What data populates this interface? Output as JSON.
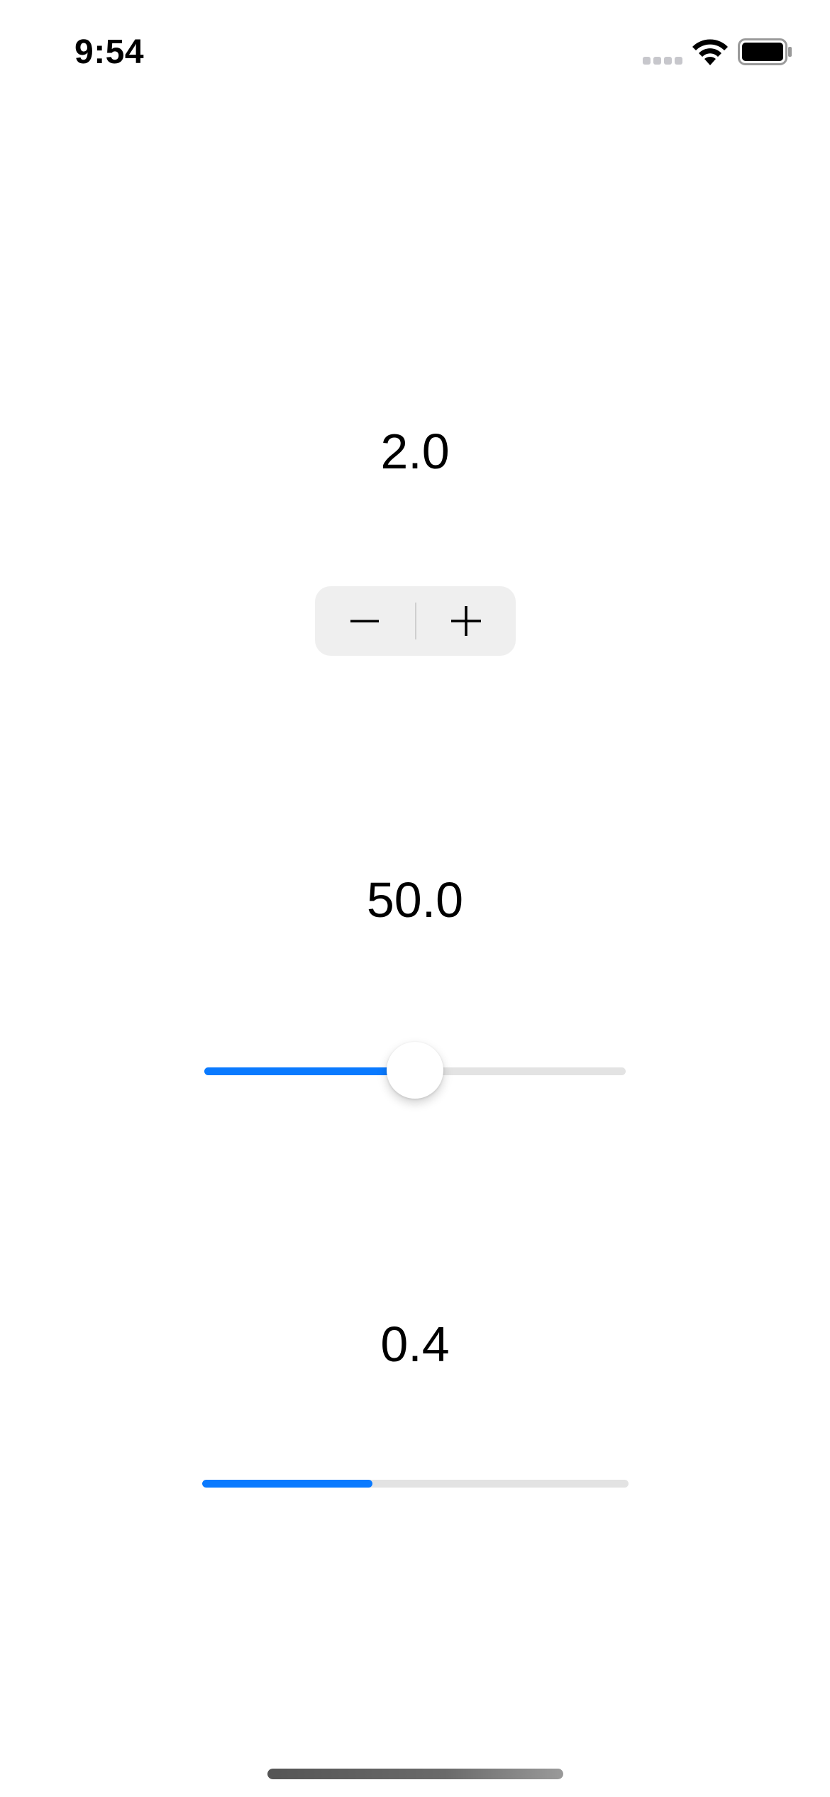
{
  "status_bar": {
    "time": "9:54",
    "icons": [
      "signal-dots-icon",
      "wifi-icon",
      "battery-icon"
    ]
  },
  "stepper_section": {
    "value_label": "2.0",
    "decrement_icon": "minus-icon",
    "increment_icon": "plus-icon"
  },
  "slider_section": {
    "value_label": "50.0",
    "value_fraction": 0.5,
    "fill_color": "#0a7aff"
  },
  "progress_section": {
    "value_label": "0.4",
    "value_fraction": 0.4,
    "fill_color": "#0a7aff"
  },
  "colors": {
    "accent": "#0a7aff",
    "track": "#e3e3e3",
    "stepper_bg": "#efefef"
  }
}
